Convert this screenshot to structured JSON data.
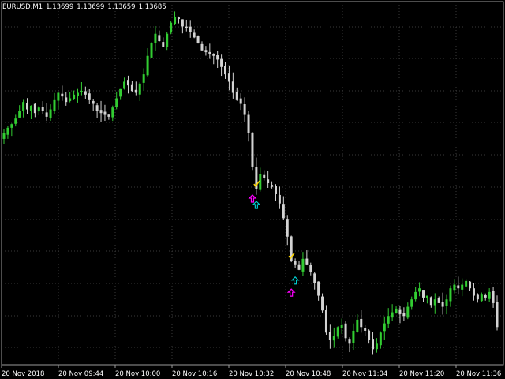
{
  "chart_data": {
    "type": "candlestick",
    "symbol": "EURUSD,M1",
    "ohlc_header": [
      "1.13699",
      "1.13699",
      "1.13659",
      "1.13685"
    ],
    "x_tick_labels": [
      "20 Nov 2018",
      "20 Nov 09:44",
      "20 Nov 10:00",
      "20 Nov 10:16",
      "20 Nov 10:32",
      "20 Nov 10:48",
      "20 Nov 11:04",
      "20 Nov 11:20",
      "20 Nov 11:36"
    ],
    "grid": "on (dotted)",
    "legend": "none",
    "colors": {
      "background": "#000000",
      "bull_candle": "#32cd32",
      "bear_candle": "#d3d3d3",
      "grid": "#3a3a3a",
      "text": "#ffffff",
      "signal_check": "#ffd700",
      "signal_arrow_cyan": "#00ced1",
      "signal_arrow_magenta": "#ff00ff"
    },
    "close_series": [
      1.1318,
      1.1321,
      1.1323,
      1.1326,
      1.133,
      1.1335,
      1.1331,
      1.1333,
      1.1329,
      1.1332,
      1.133,
      1.1327,
      1.1331,
      1.1336,
      1.134,
      1.1338,
      1.1335,
      1.1337,
      1.1339,
      1.134,
      1.1341,
      1.1339,
      1.1336,
      1.1334,
      1.133,
      1.1329,
      1.1328,
      1.1327,
      1.1332,
      1.1337,
      1.1342,
      1.1346,
      1.1344,
      1.1341,
      1.134,
      1.1345,
      1.135,
      1.136,
      1.1367,
      1.1372,
      1.1368,
      1.1365,
      1.1372,
      1.1378,
      1.1381,
      1.138,
      1.1376,
      1.1375,
      1.1373,
      1.137,
      1.1367,
      1.1363,
      1.1362,
      1.1361,
      1.136,
      1.1358,
      1.1354,
      1.135,
      1.1346,
      1.134,
      1.1336,
      1.1334,
      1.1328,
      1.1318,
      1.13,
      1.1288,
      1.1296,
      1.1294,
      1.1291,
      1.1289,
      1.1285,
      1.128,
      1.1272,
      1.1262,
      1.1249,
      1.1247,
      1.1244,
      1.125,
      1.1247,
      1.1243,
      1.1237,
      1.123,
      1.1222,
      1.121,
      1.1206,
      1.1208,
      1.1213,
      1.1214,
      1.1207,
      1.1204,
      1.1211,
      1.1217,
      1.1213,
      1.1211,
      1.1206,
      1.1201,
      1.1204,
      1.121,
      1.1215,
      1.1219,
      1.1221,
      1.1223,
      1.122,
      1.1219,
      1.1224,
      1.1228,
      1.1232,
      1.1234,
      1.1229,
      1.123,
      1.1225,
      1.1228,
      1.1226,
      1.1224,
      1.1228,
      1.1234,
      1.1236,
      1.1234,
      1.1236,
      1.1238,
      1.1234,
      1.123,
      1.1228,
      1.1231,
      1.1229,
      1.1232,
      1.1226,
      1.1213
    ],
    "y_range": [
      1.1196,
      1.1386
    ],
    "signals": [
      {
        "type": "check",
        "at_index": 65
      },
      {
        "type": "arrow-up-cyan",
        "at_index": 65
      },
      {
        "type": "arrow-up-magenta",
        "at_index": 64
      },
      {
        "type": "check",
        "at_index": 74
      },
      {
        "type": "arrow-up-magenta",
        "at_index": 74
      },
      {
        "type": "arrow-up-cyan",
        "at_index": 75
      }
    ]
  }
}
